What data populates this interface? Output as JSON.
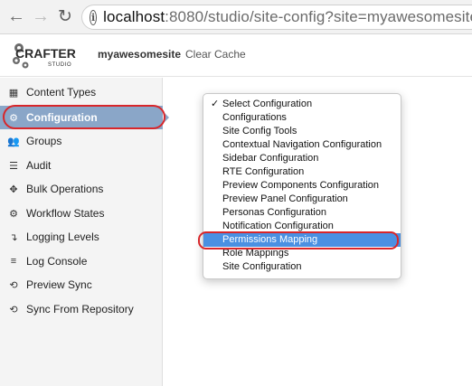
{
  "browser": {
    "back_glyph": "←",
    "forward_glyph": "→",
    "reload_glyph": "↻",
    "info_glyph": "i",
    "url_host": "localhost",
    "url_rest": ":8080/studio/site-config?site=myawesomesite"
  },
  "header": {
    "logo_top": "CRAFTER",
    "logo_bottom": "STUDIO",
    "site_name": "myawesomesite",
    "clear_cache_label": "Clear Cache"
  },
  "sidebar": {
    "items": [
      {
        "label": "Content Types",
        "icon": "grid-icon",
        "glyph": "▦"
      },
      {
        "label": "Configuration",
        "icon": "gear-icon",
        "glyph": "⚙",
        "active": true
      },
      {
        "label": "Groups",
        "icon": "users-icon",
        "glyph": "👥"
      },
      {
        "label": "Audit",
        "icon": "list-icon",
        "glyph": "☰"
      },
      {
        "label": "Bulk Operations",
        "icon": "arrows-icon",
        "glyph": "✥"
      },
      {
        "label": "Workflow States",
        "icon": "gear-icon",
        "glyph": "⚙"
      },
      {
        "label": "Logging Levels",
        "icon": "level-down-icon",
        "glyph": "↴"
      },
      {
        "label": "Log Console",
        "icon": "align-left-icon",
        "glyph": "≡"
      },
      {
        "label": "Preview Sync",
        "icon": "refresh-icon",
        "glyph": "⟲"
      },
      {
        "label": "Sync From Repository",
        "icon": "refresh-icon",
        "glyph": "⟲"
      }
    ]
  },
  "dropdown": {
    "check_glyph": "✓",
    "options": [
      {
        "label": "Select Configuration",
        "selected": true
      },
      {
        "label": "Configurations"
      },
      {
        "label": "Site Config Tools"
      },
      {
        "label": "Contextual Navigation Configuration"
      },
      {
        "label": "Sidebar Configuration"
      },
      {
        "label": "RTE Configuration"
      },
      {
        "label": "Preview Components Configuration"
      },
      {
        "label": "Preview Panel Configuration"
      },
      {
        "label": "Personas Configuration"
      },
      {
        "label": "Notification Configuration"
      },
      {
        "label": "Permissions Mapping",
        "highlighted": true
      },
      {
        "label": "Role Mappings"
      },
      {
        "label": "Site Configuration"
      }
    ]
  },
  "colors": {
    "active_item": "#8aa6c8",
    "highlight": "#4a90e2",
    "annotation_ring": "#d8262a"
  }
}
